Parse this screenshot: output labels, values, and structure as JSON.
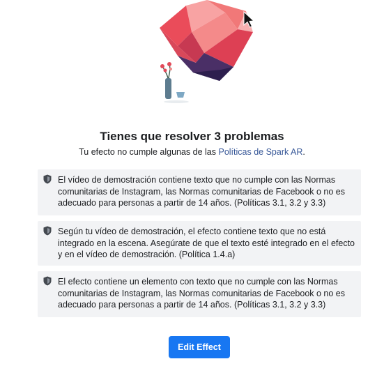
{
  "header": {
    "title": "Tienes que resolver 3 problemas",
    "subtitle_prefix": "Tu efecto no cumple algunas de las ",
    "subtitle_link": "Políticas de Spark AR",
    "subtitle_suffix": "."
  },
  "issues": [
    {
      "icon": "shield-icon",
      "text": "El vídeo de demostración contiene texto que no cumple con las Normas comunitarias de Instagram, las Normas comunitarias de Facebook o no es adecuado para personas a partir de 14 años. (Políticas 3.1, 3.2 y 3.3)"
    },
    {
      "icon": "shield-icon",
      "text": "Según tu vídeo de demostración, el efecto contiene texto que no está integrado en la escena. Asegúrate de que el texto esté integrado en el efecto y en el vídeo de demostración. (Política 1.4.a)"
    },
    {
      "icon": "shield-icon",
      "text": "El efecto contiene un elemento con texto que no cumple con las Normas comunitarias de Instagram, las Normas comunitarias de Facebook o no es adecuado para personas a partir de 14 años. (Políticas 3.1, 3.2 y 3.3)"
    }
  ],
  "actions": {
    "edit_label": "Edit Effect"
  },
  "colors": {
    "accent": "#1877f2",
    "link": "#385898",
    "issue_background": "#f2f3f5"
  }
}
